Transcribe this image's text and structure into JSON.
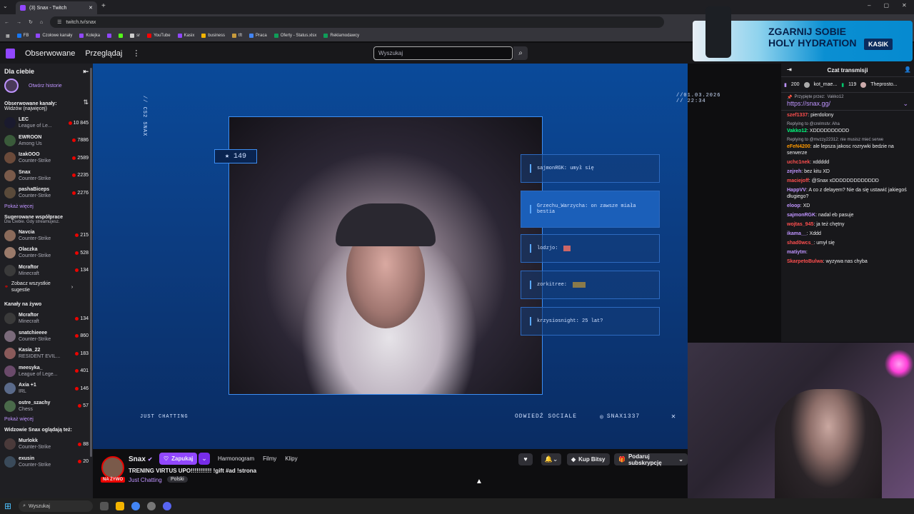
{
  "browser": {
    "tab_title": "(3) Snax - Twitch",
    "url": "twitch.tv/snax",
    "bookmarks": [
      "FB",
      "Czołowe kanały",
      "Kolejka",
      "",
      "",
      "sr",
      "YouTube",
      "Kasix",
      "business",
      "tft",
      "Praca",
      "Oferty - Status.xlsx",
      "Reklamodawcy"
    ]
  },
  "topnav": {
    "following": "Obserwowane",
    "browse": "Przeglądaj",
    "more": "⋮",
    "search_placeholder": "Wyszukaj"
  },
  "sidebar": {
    "for_you": "Dla ciebie",
    "open_stories": "Otwórz historie",
    "followed_title": "Obserwowane kanały:",
    "followed_sort": "Widzów (najwięcej)",
    "followed": [
      {
        "name": "LEC",
        "game": "League of Le...",
        "viewers": "10 845",
        "color": "#1a1a2e"
      },
      {
        "name": "EWROON",
        "game": "Among Us",
        "viewers": "7886",
        "color": "#3a5a3a"
      },
      {
        "name": "IzakOOO",
        "game": "Counter-Strike",
        "viewers": "2589",
        "color": "#6b4a3a"
      },
      {
        "name": "Snax",
        "game": "Counter-Strike",
        "viewers": "2235",
        "color": "#7a5a4a"
      },
      {
        "name": "pashaBiceps",
        "game": "Counter-Strike",
        "viewers": "2276",
        "color": "#5a4a3a"
      }
    ],
    "show_more": "Pokaż więcej",
    "recommended_title": "Sugerowane współprace",
    "recommended_sub": "Dla Ciebie. Gdy streamujesz.",
    "recommended": [
      {
        "name": "Navcia",
        "game": "Counter-Strike",
        "viewers": "215",
        "color": "#8a6a5a"
      },
      {
        "name": "Olaczka",
        "game": "Counter-Strike",
        "viewers": "528",
        "color": "#9a7a6a"
      },
      {
        "name": "Mcraftor",
        "game": "Minecraft",
        "viewers": "134",
        "color": "#3a3a3a"
      }
    ],
    "see_all": "Zobacz wszystkie sugestie",
    "live_title": "Kanały na żywo",
    "live": [
      {
        "name": "Mcraftor",
        "game": "Minecraft",
        "viewers": "134",
        "color": "#3a3a3a"
      },
      {
        "name": "snatchieeee",
        "game": "Counter-Strike",
        "viewers": "860",
        "color": "#7a6a7a"
      },
      {
        "name": "Kasia_22",
        "game": "RESIDENT EVIL...",
        "viewers": "183",
        "color": "#8a5a5a"
      },
      {
        "name": "meesyka_",
        "game": "League of Lege...",
        "viewers": "401",
        "color": "#6a4a6a"
      },
      {
        "name": "Axia +1",
        "game": "IRL",
        "viewers": "146",
        "color": "#5a6a8a"
      },
      {
        "name": "ostre_szachy",
        "game": "Chess",
        "viewers": "57",
        "color": "#4a6a4a"
      }
    ],
    "show_more2": "Pokaż więcej",
    "also_title": "Widzowie Snax oglądają też:",
    "also": [
      {
        "name": "Murlokk",
        "game": "Counter-Strike",
        "viewers": "88",
        "color": "#4a3a3a"
      },
      {
        "name": "exusin",
        "game": "Counter-Strike",
        "viewers": "20",
        "color": "#3a4a5a"
      }
    ]
  },
  "stream_overlay": {
    "sub_count": "149",
    "date": "//01.03.2026 // 22:34",
    "side_tag": "// CS2 SNAX",
    "category_tag": "JUST CHATTING",
    "socials_label": "ODWIEDŹ SOCIALE",
    "socials_handle": "SNAX1337",
    "messages": [
      {
        "user": "sajmonRGK:",
        "text": "umył się"
      },
      {
        "user": "Grzechu_Warzycha:",
        "text": "on zawsze miała bestia"
      },
      {
        "user": "lodzjo:",
        "text": ""
      },
      {
        "user": "zorkitree:",
        "text": ""
      },
      {
        "user": "krzysiosnight:",
        "text": "25 lat?"
      }
    ]
  },
  "stream_info": {
    "channel": "Snax",
    "follow_label": "Zapukaj",
    "tabs": [
      "Harmonogram",
      "Filmy",
      "Klipy"
    ],
    "title": "TRENING VIRTUS UPO!!!!!!!!!!! !gift #ad !strona",
    "live_badge": "NA ŻYWO",
    "category": "Just Chatting",
    "tag": "Polski",
    "buy_bits": "Kup Bitsy",
    "gift_sub": "Podaruj subskrypcję"
  },
  "chat": {
    "title": "Czat transmisji",
    "pinned_stats": [
      "200",
      "kot_mae...",
      "119",
      "Theprosto..."
    ],
    "pinned_by": "Przypięte przez:",
    "pinned_by_user": "Vakko12",
    "pinned_link": "https://snax.gg/",
    "messages": [
      {
        "user": "szef1337",
        "text": "pierdolony",
        "color": "#ff4f4f"
      },
      {
        "reply": "Replying to @crelmstv: Aha",
        "user": "Vakko12",
        "text": "XDDDDDDDDDD",
        "color": "#00ff7f"
      },
      {
        "reply": "Replying to @mvzzy22312: nie musisz mieć serwe",
        "user": "eFeN4200",
        "text": "ale lepsza jakosc rozrywki bedzie na serwerze",
        "color": "#ff9900"
      },
      {
        "user": "uchc1nek",
        "text": "xddddd",
        "color": "#ff4f4f"
      },
      {
        "user": "zejreh",
        "text": "bez kitu XD",
        "color": "#bf94ff"
      },
      {
        "user": "maciejoff",
        "text": "@Snax xDDDDDDDDDDDDD",
        "color": "#ff4f4f"
      },
      {
        "user": "HappVV",
        "text": "A co z delayem? Nie da się ustawić jakiegoś długiego?",
        "color": "#bf94ff"
      },
      {
        "user": "eloop",
        "text": "XD",
        "color": "#bf94ff"
      },
      {
        "user": "sajmonRGK",
        "text": "nadal eb pasuje",
        "color": "#bf94ff"
      },
      {
        "user": "wojtas_945",
        "text": "ja też chętny",
        "color": "#ff4f4f"
      },
      {
        "user": "ikama__",
        "text": "Xddd",
        "color": "#bf94ff"
      },
      {
        "user": "shad0wcs_",
        "text": "umył się",
        "color": "#ff4f4f"
      },
      {
        "user": "matiytm",
        "text": "",
        "color": "#bf94ff"
      },
      {
        "user": "SkarpetoBulwa",
        "text": "wyzywa nas chyba",
        "color": "#ff4f4f"
      }
    ]
  },
  "ad": {
    "line1": "ZGARNIJ SOBIE",
    "line2": "HOLY HYDRATION",
    "badge": "KASIK"
  },
  "taskbar": {
    "search": "Wyszukaj"
  }
}
